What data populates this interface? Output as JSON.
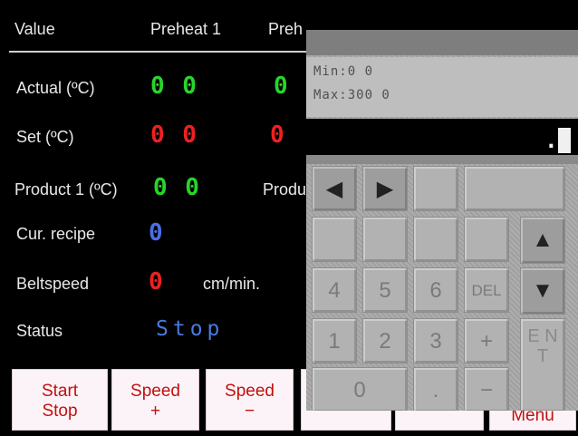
{
  "header": {
    "value_label": "Value",
    "preheat1_label": "Preheat 1",
    "preheat2_label_partial": "Preh"
  },
  "rows": {
    "actual_label": "Actual  (ºC)",
    "actual_preheat1": "0 0",
    "actual_preheat2": "0",
    "set_label": "Set     (ºC)",
    "set_preheat1": "0 0",
    "set_preheat2": "0",
    "product1_label": "Product 1  (ºC)",
    "product1_value": "0 0",
    "product_partial_label": "Produ",
    "recipe_label": "Cur. recipe",
    "recipe_value": "0",
    "beltspeed_label": "Beltspeed",
    "beltspeed_value": "0",
    "beltspeed_unit": "cm/min.",
    "status_label": "Status",
    "status_value": "Stop"
  },
  "buttons": {
    "start_stop_line1": "Start",
    "start_stop_line2": "Stop",
    "speed_plus_line1": "Speed",
    "speed_plus_line2": "+",
    "speed_minus_line1": "Speed",
    "speed_minus_line2": "−",
    "menu_partial": "Menu"
  },
  "keypad": {
    "min_text": "Min:0 0",
    "max_text": "Max:300 0",
    "display_prefix": "",
    "display_cursor": "0",
    "display_suffix": ".0",
    "keys": {
      "left": "◀",
      "right": "▶",
      "up": "▲",
      "down": "▼",
      "k4": "4",
      "k5": "5",
      "k6": "6",
      "del": "DEL",
      "k1": "1",
      "k2": "2",
      "k3": "3",
      "plus": "+",
      "k0": "0",
      "dot": ".",
      "minus": "−",
      "enter": "E N T"
    }
  },
  "colors": {
    "actual": "#27d52a",
    "set": "#ee2020",
    "recipe": "#4a6fe6",
    "status": "#4a7ae0",
    "button_text": "#c21010"
  }
}
